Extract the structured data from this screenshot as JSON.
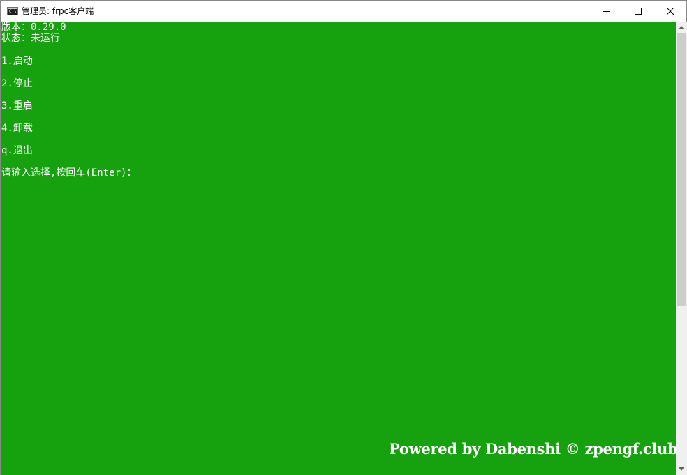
{
  "window": {
    "title": "管理员:  frpc客户端",
    "icon": "console-icon",
    "icon_text": "C:\\",
    "controls": {
      "minimize_icon": "minimize-icon",
      "maximize_icon": "maximize-icon",
      "close_icon": "close-icon"
    }
  },
  "console": {
    "background": "#16a10e",
    "text_color": "#ffffff",
    "lines": [
      "版本：0.29.0",
      "状态：未运行",
      "1.启动",
      "2.停止",
      "3.重启",
      "4.卸载",
      "q.退出",
      "请输入选择,按回车(Enter)："
    ],
    "watermark": "Powered by Dabenshi © zpengf.club"
  },
  "scrollbar": {
    "up_icon": "scroll-up-arrow-icon",
    "down_icon": "scroll-down-arrow-icon"
  }
}
